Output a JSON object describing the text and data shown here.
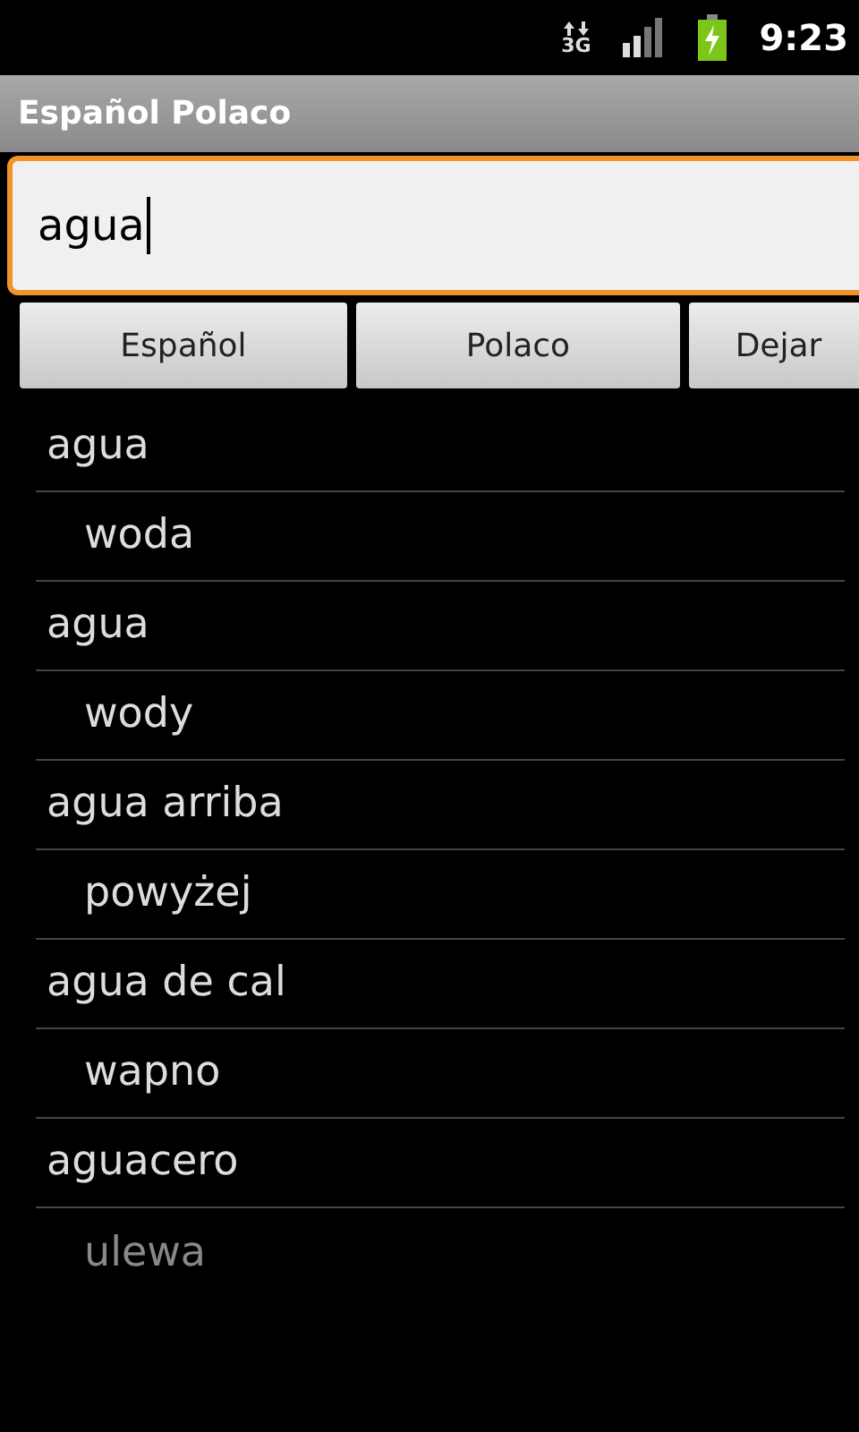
{
  "status_bar": {
    "network": "3G",
    "time": "9:23"
  },
  "title_bar": {
    "title": "Español Polaco"
  },
  "search": {
    "value": "agua"
  },
  "buttons": [
    "Español",
    "Polaco",
    "Dejar"
  ],
  "results": [
    {
      "kind": "term",
      "text": "agua"
    },
    {
      "kind": "translation",
      "text": "woda"
    },
    {
      "kind": "term",
      "text": "agua"
    },
    {
      "kind": "translation",
      "text": "wody"
    },
    {
      "kind": "term",
      "text": "agua arriba"
    },
    {
      "kind": "translation",
      "text": "powyżej"
    },
    {
      "kind": "term",
      "text": "agua de cal"
    },
    {
      "kind": "translation",
      "text": "wapno"
    },
    {
      "kind": "term",
      "text": "aguacero"
    },
    {
      "kind": "translation",
      "text": "ulewa"
    }
  ]
}
